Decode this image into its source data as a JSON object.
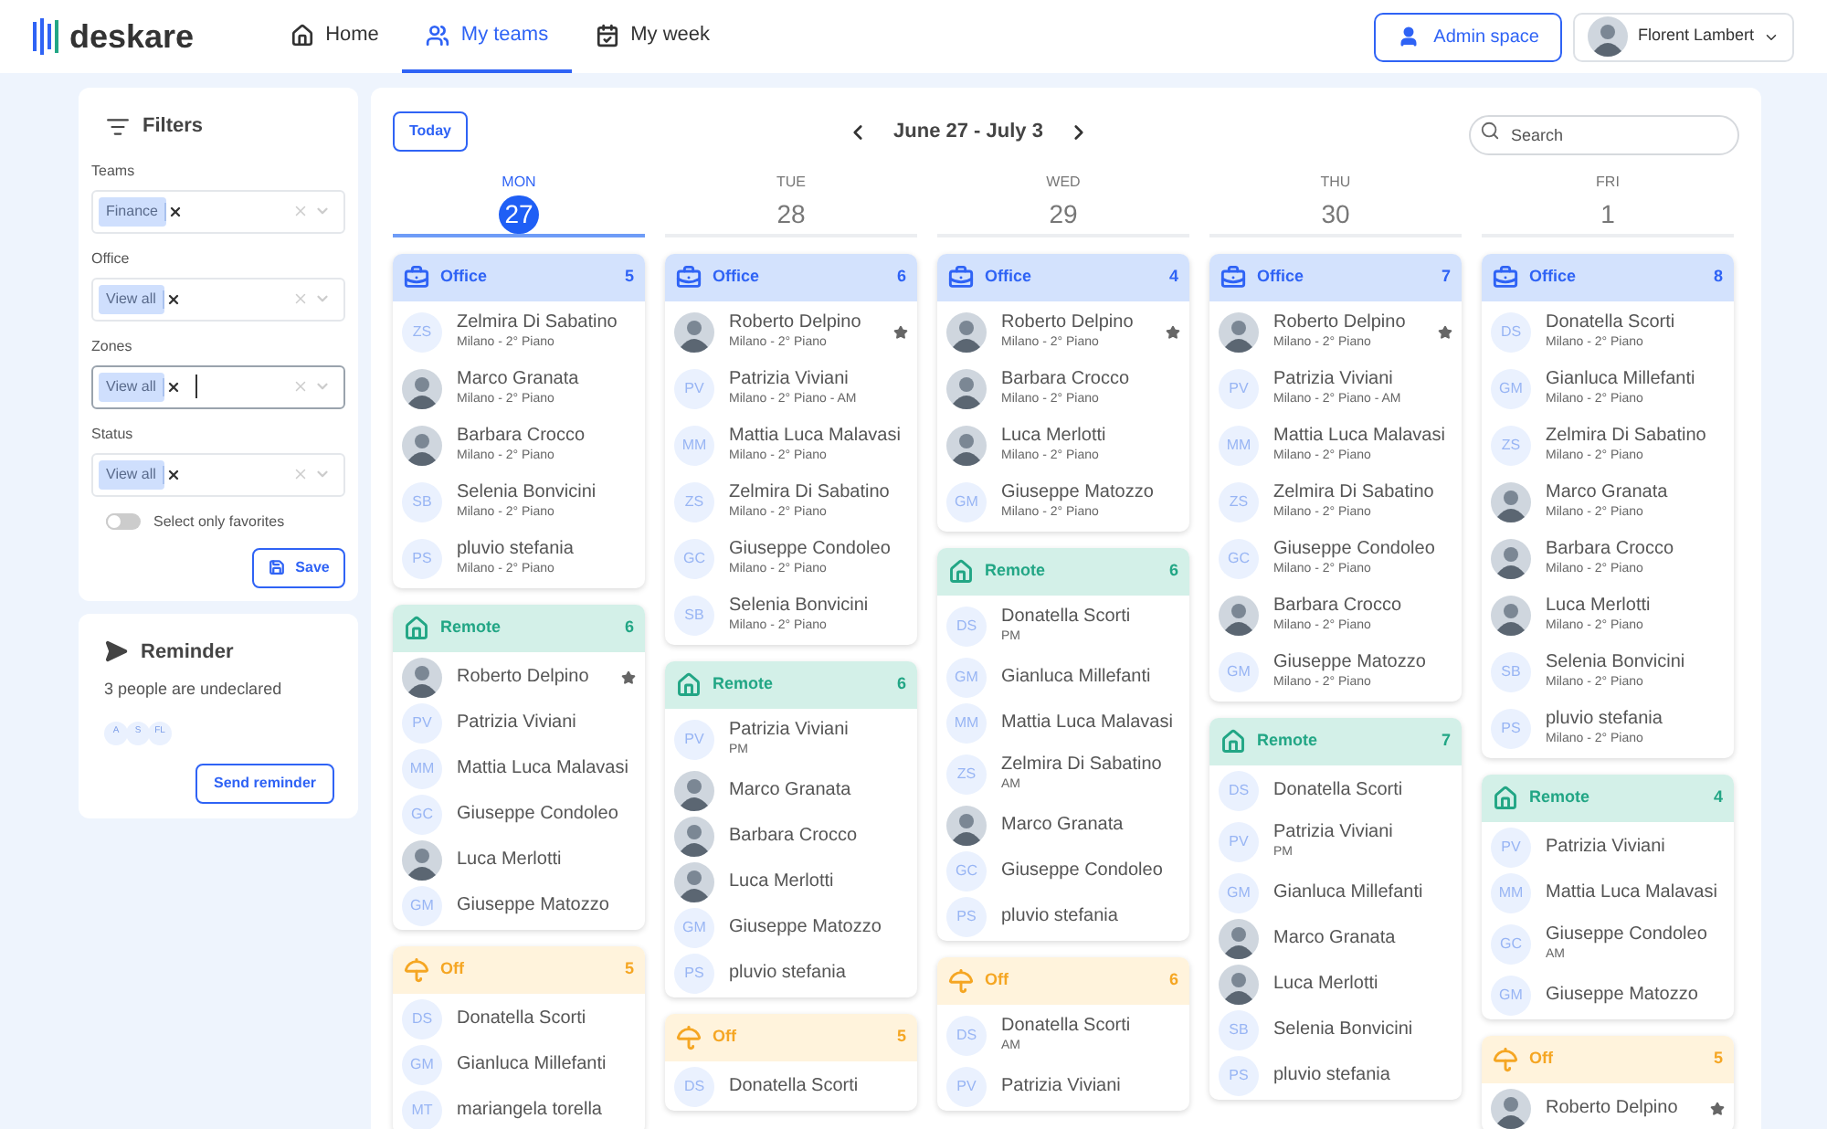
{
  "brand": "deskare",
  "nav": [
    {
      "label": "Home",
      "selected": false
    },
    {
      "label": "My teams",
      "selected": true
    },
    {
      "label": "My week",
      "selected": false
    }
  ],
  "admin_button": "Admin space",
  "user": {
    "name": "Florent Lambert"
  },
  "filters": {
    "title": "Filters",
    "fields": [
      {
        "label": "Teams",
        "chip": "Finance",
        "focused": false
      },
      {
        "label": "Office",
        "chip": "View all",
        "focused": false
      },
      {
        "label": "Zones",
        "chip": "View all",
        "focused": true
      },
      {
        "label": "Status",
        "chip": "View all",
        "focused": false
      }
    ],
    "favorites_toggle": {
      "label": "Select only favorites",
      "on": false
    },
    "save": "Save"
  },
  "reminder": {
    "title": "Reminder",
    "text": "3 people are undeclared",
    "initials": [
      "A",
      "S",
      "FL"
    ],
    "button": "Send reminder"
  },
  "toolbar": {
    "today": "Today",
    "range": "June 27 - July 3",
    "search_placeholder": "Search"
  },
  "days": [
    {
      "weekday": "MON",
      "date": "27",
      "selected": true,
      "groups": [
        {
          "kind": "office",
          "label": "Office",
          "count": "5",
          "people": [
            {
              "kind": "initials",
              "initials": "ZS",
              "name": "Zelmira Di Sabatino",
              "detail": "Milano - 2° Piano",
              "favorite": false
            },
            {
              "kind": "photo",
              "name": "Marco Granata",
              "detail": "Milano - 2° Piano",
              "favorite": false
            },
            {
              "kind": "photo",
              "name": "Barbara Crocco",
              "detail": "Milano - 2° Piano",
              "favorite": false
            },
            {
              "kind": "initials",
              "initials": "SB",
              "name": "Selenia Bonvicini",
              "detail": "Milano - 2° Piano",
              "favorite": false
            },
            {
              "kind": "initials",
              "initials": "PS",
              "name": "pluvio stefania",
              "detail": "Milano - 2° Piano",
              "favorite": false
            }
          ]
        },
        {
          "kind": "remote",
          "label": "Remote",
          "count": "6",
          "people": [
            {
              "kind": "photo",
              "name": "Roberto Delpino",
              "favorite": true
            },
            {
              "kind": "initials",
              "initials": "PV",
              "name": "Patrizia Viviani",
              "favorite": false
            },
            {
              "kind": "initials",
              "initials": "MM",
              "name": "Mattia Luca Malavasi",
              "favorite": false
            },
            {
              "kind": "initials",
              "initials": "GC",
              "name": "Giuseppe Condoleo",
              "favorite": false
            },
            {
              "kind": "photo",
              "name": "Luca Merlotti",
              "favorite": false
            },
            {
              "kind": "initials",
              "initials": "GM",
              "name": "Giuseppe Matozzo",
              "favorite": false
            }
          ]
        },
        {
          "kind": "off",
          "label": "Off",
          "count": "5",
          "people": [
            {
              "kind": "initials",
              "initials": "DS",
              "name": "Donatella Scorti",
              "favorite": false
            },
            {
              "kind": "initials",
              "initials": "GM",
              "name": "Gianluca Millefanti",
              "favorite": false
            },
            {
              "kind": "initials",
              "initials": "MT",
              "name": "mariangela torella",
              "favorite": false
            }
          ]
        }
      ]
    },
    {
      "weekday": "TUE",
      "date": "28",
      "selected": false,
      "groups": [
        {
          "kind": "office",
          "label": "Office",
          "count": "6",
          "people": [
            {
              "kind": "photo",
              "name": "Roberto Delpino",
              "detail": "Milano - 2° Piano",
              "favorite": true
            },
            {
              "kind": "initials",
              "initials": "PV",
              "name": "Patrizia Viviani",
              "detail": "Milano - 2° Piano - AM",
              "favorite": false
            },
            {
              "kind": "initials",
              "initials": "MM",
              "name": "Mattia Luca Malavasi",
              "detail": "Milano - 2° Piano",
              "favorite": false
            },
            {
              "kind": "initials",
              "initials": "ZS",
              "name": "Zelmira Di Sabatino",
              "detail": "Milano - 2° Piano",
              "favorite": false
            },
            {
              "kind": "initials",
              "initials": "GC",
              "name": "Giuseppe Condoleo",
              "detail": "Milano - 2° Piano",
              "favorite": false
            },
            {
              "kind": "initials",
              "initials": "SB",
              "name": "Selenia Bonvicini",
              "detail": "Milano - 2° Piano",
              "favorite": false
            }
          ]
        },
        {
          "kind": "remote",
          "label": "Remote",
          "count": "6",
          "people": [
            {
              "kind": "initials",
              "initials": "PV",
              "name": "Patrizia Viviani",
              "detail": "PM",
              "favorite": false
            },
            {
              "kind": "photo",
              "name": "Marco Granata",
              "favorite": false
            },
            {
              "kind": "photo",
              "name": "Barbara Crocco",
              "favorite": false
            },
            {
              "kind": "photo",
              "name": "Luca Merlotti",
              "favorite": false
            },
            {
              "kind": "initials",
              "initials": "GM",
              "name": "Giuseppe Matozzo",
              "favorite": false
            },
            {
              "kind": "initials",
              "initials": "PS",
              "name": "pluvio stefania",
              "favorite": false
            }
          ]
        },
        {
          "kind": "off",
          "label": "Off",
          "count": "5",
          "people": [
            {
              "kind": "initials",
              "initials": "DS",
              "name": "Donatella Scorti",
              "favorite": false
            }
          ]
        }
      ]
    },
    {
      "weekday": "WED",
      "date": "29",
      "selected": false,
      "groups": [
        {
          "kind": "office",
          "label": "Office",
          "count": "4",
          "people": [
            {
              "kind": "photo",
              "name": "Roberto Delpino",
              "detail": "Milano - 2° Piano",
              "favorite": true
            },
            {
              "kind": "photo",
              "name": "Barbara Crocco",
              "detail": "Milano - 2° Piano",
              "favorite": false
            },
            {
              "kind": "photo",
              "name": "Luca Merlotti",
              "detail": "Milano - 2° Piano",
              "favorite": false
            },
            {
              "kind": "initials",
              "initials": "GM",
              "name": "Giuseppe Matozzo",
              "detail": "Milano - 2° Piano",
              "favorite": false
            }
          ]
        },
        {
          "kind": "remote",
          "label": "Remote",
          "count": "6",
          "people": [
            {
              "kind": "initials",
              "initials": "DS",
              "name": "Donatella Scorti",
              "detail": "PM",
              "favorite": false
            },
            {
              "kind": "initials",
              "initials": "GM",
              "name": "Gianluca Millefanti",
              "favorite": false
            },
            {
              "kind": "initials",
              "initials": "MM",
              "name": "Mattia Luca Malavasi",
              "favorite": false
            },
            {
              "kind": "initials",
              "initials": "ZS",
              "name": "Zelmira Di Sabatino",
              "detail": "AM",
              "favorite": false
            },
            {
              "kind": "photo",
              "name": "Marco Granata",
              "favorite": false
            },
            {
              "kind": "initials",
              "initials": "GC",
              "name": "Giuseppe Condoleo",
              "favorite": false
            },
            {
              "kind": "initials",
              "initials": "PS",
              "name": "pluvio stefania",
              "favorite": false
            }
          ]
        },
        {
          "kind": "off",
          "label": "Off",
          "count": "6",
          "people": [
            {
              "kind": "initials",
              "initials": "DS",
              "name": "Donatella Scorti",
              "detail": "AM",
              "favorite": false
            },
            {
              "kind": "initials",
              "initials": "PV",
              "name": "Patrizia Viviani",
              "favorite": false
            }
          ]
        }
      ]
    },
    {
      "weekday": "THU",
      "date": "30",
      "selected": false,
      "groups": [
        {
          "kind": "office",
          "label": "Office",
          "count": "7",
          "people": [
            {
              "kind": "photo",
              "name": "Roberto Delpino",
              "detail": "Milano - 2° Piano",
              "favorite": true
            },
            {
              "kind": "initials",
              "initials": "PV",
              "name": "Patrizia Viviani",
              "detail": "Milano - 2° Piano - AM",
              "favorite": false
            },
            {
              "kind": "initials",
              "initials": "MM",
              "name": "Mattia Luca Malavasi",
              "detail": "Milano - 2° Piano",
              "favorite": false
            },
            {
              "kind": "initials",
              "initials": "ZS",
              "name": "Zelmira Di Sabatino",
              "detail": "Milano - 2° Piano",
              "favorite": false
            },
            {
              "kind": "initials",
              "initials": "GC",
              "name": "Giuseppe Condoleo",
              "detail": "Milano - 2° Piano",
              "favorite": false
            },
            {
              "kind": "photo",
              "name": "Barbara Crocco",
              "detail": "Milano - 2° Piano",
              "favorite": false
            },
            {
              "kind": "initials",
              "initials": "GM",
              "name": "Giuseppe Matozzo",
              "detail": "Milano - 2° Piano",
              "favorite": false
            }
          ]
        },
        {
          "kind": "remote",
          "label": "Remote",
          "count": "7",
          "people": [
            {
              "kind": "initials",
              "initials": "DS",
              "name": "Donatella Scorti",
              "favorite": false
            },
            {
              "kind": "initials",
              "initials": "PV",
              "name": "Patrizia Viviani",
              "detail": "PM",
              "favorite": false
            },
            {
              "kind": "initials",
              "initials": "GM",
              "name": "Gianluca Millefanti",
              "favorite": false
            },
            {
              "kind": "photo",
              "name": "Marco Granata",
              "favorite": false
            },
            {
              "kind": "photo",
              "name": "Luca Merlotti",
              "favorite": false
            },
            {
              "kind": "initials",
              "initials": "SB",
              "name": "Selenia Bonvicini",
              "favorite": false
            },
            {
              "kind": "initials",
              "initials": "PS",
              "name": "pluvio stefania",
              "favorite": false
            }
          ]
        }
      ]
    },
    {
      "weekday": "FRI",
      "date": "1",
      "selected": false,
      "groups": [
        {
          "kind": "office",
          "label": "Office",
          "count": "8",
          "people": [
            {
              "kind": "initials",
              "initials": "DS",
              "name": "Donatella Scorti",
              "detail": "Milano - 2° Piano",
              "favorite": false
            },
            {
              "kind": "initials",
              "initials": "GM",
              "name": "Gianluca Millefanti",
              "detail": "Milano - 2° Piano",
              "favorite": false
            },
            {
              "kind": "initials",
              "initials": "ZS",
              "name": "Zelmira Di Sabatino",
              "detail": "Milano - 2° Piano",
              "favorite": false
            },
            {
              "kind": "photo",
              "name": "Marco Granata",
              "detail": "Milano - 2° Piano",
              "favorite": false
            },
            {
              "kind": "photo",
              "name": "Barbara Crocco",
              "detail": "Milano - 2° Piano",
              "favorite": false
            },
            {
              "kind": "photo",
              "name": "Luca Merlotti",
              "detail": "Milano - 2° Piano",
              "favorite": false
            },
            {
              "kind": "initials",
              "initials": "SB",
              "name": "Selenia Bonvicini",
              "detail": "Milano - 2° Piano",
              "favorite": false
            },
            {
              "kind": "initials",
              "initials": "PS",
              "name": "pluvio stefania",
              "detail": "Milano - 2° Piano",
              "favorite": false
            }
          ]
        },
        {
          "kind": "remote",
          "label": "Remote",
          "count": "4",
          "people": [
            {
              "kind": "initials",
              "initials": "PV",
              "name": "Patrizia Viviani",
              "favorite": false
            },
            {
              "kind": "initials",
              "initials": "MM",
              "name": "Mattia Luca Malavasi",
              "favorite": false
            },
            {
              "kind": "initials",
              "initials": "GC",
              "name": "Giuseppe Condoleo",
              "detail": "AM",
              "favorite": false
            },
            {
              "kind": "initials",
              "initials": "GM",
              "name": "Giuseppe Matozzo",
              "favorite": false
            }
          ]
        },
        {
          "kind": "off",
          "label": "Off",
          "count": "5",
          "people": [
            {
              "kind": "photo",
              "name": "Roberto Delpino",
              "favorite": true
            }
          ]
        }
      ]
    }
  ]
}
